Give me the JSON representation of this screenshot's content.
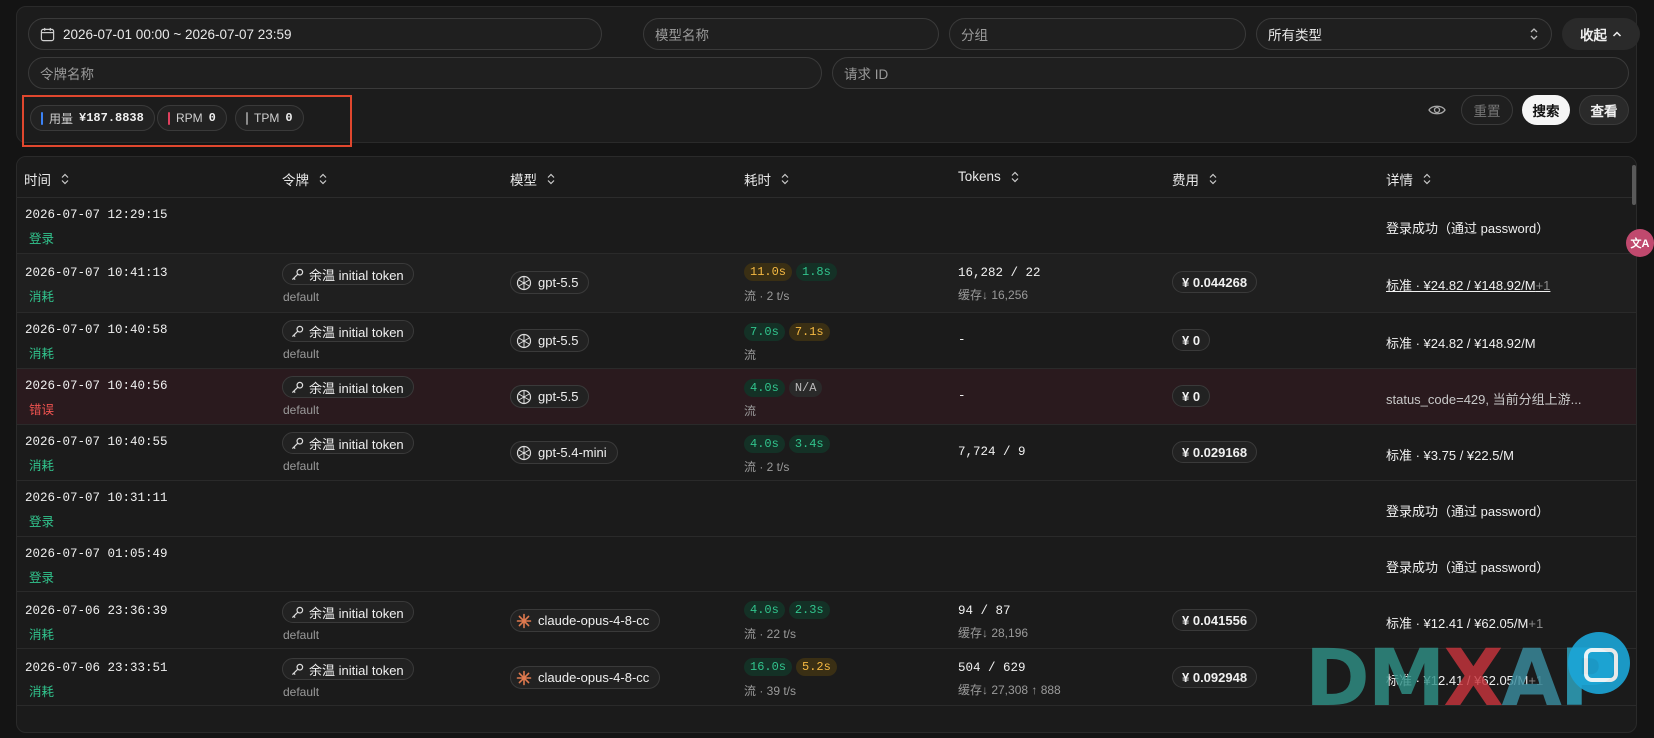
{
  "filters": {
    "date_range": "2026-07-01 00:00 ~ 2026-07-07 23:59",
    "model_placeholder": "模型名称",
    "group_placeholder": "分组",
    "type_select": "所有类型",
    "collapse_label": "收起",
    "token_placeholder": "令牌名称",
    "request_id_placeholder": "请求 ID"
  },
  "stats": {
    "usage_label": "用量",
    "usage_value": "¥187.8838",
    "rpm_label": "RPM",
    "rpm_value": "0",
    "tpm_label": "TPM",
    "tpm_value": "0",
    "colors": {
      "usage": "#3b82f6",
      "rpm": "#e0405e",
      "tpm": "#8a8a8a"
    }
  },
  "actions": {
    "reset": "重置",
    "search": "搜索",
    "view": "查看"
  },
  "columns": [
    "时间",
    "令牌",
    "模型",
    "耗时",
    "Tokens",
    "费用",
    "详情"
  ],
  "rows": [
    {
      "time": "2026-07-07 12:29:15",
      "type": "登录",
      "detail": "登录成功（通过 password）"
    },
    {
      "time": "2026-07-07 10:41:13",
      "type": "消耗",
      "token": "余温 initial token",
      "group": "default",
      "model": "gpt-5.5",
      "d1": "11.0s",
      "d2": "1.8s",
      "stream": "流 · 2 t/s",
      "tokens": "16,282 / 22",
      "cache": "缓存↓ 16,256",
      "fee": "¥ 0.044268",
      "detail": "标准 · ¥24.82 / ¥148.92/M",
      "more": "+1"
    },
    {
      "time": "2026-07-07 10:40:58",
      "type": "消耗",
      "token": "余温 initial token",
      "group": "default",
      "model": "gpt-5.5",
      "d1": "7.0s",
      "d2": "7.1s",
      "stream": "流",
      "tokens": "-",
      "fee": "¥ 0",
      "detail": "标准 · ¥24.82 / ¥148.92/M"
    },
    {
      "time": "2026-07-07 10:40:56",
      "type": "错误",
      "token": "余温 initial token",
      "group": "default",
      "model": "gpt-5.5",
      "d1": "4.0s",
      "d2": "N/A",
      "stream": "流",
      "tokens": "-",
      "fee": "¥ 0",
      "detail": "status_code=429, 当前分组上游..."
    },
    {
      "time": "2026-07-07 10:40:55",
      "type": "消耗",
      "token": "余温 initial token",
      "group": "default",
      "model": "gpt-5.4-mini",
      "d1": "4.0s",
      "d2": "3.4s",
      "stream": "流 · 2 t/s",
      "tokens": "7,724 / 9",
      "fee": "¥ 0.029168",
      "detail": "标准 · ¥3.75 / ¥22.5/M"
    },
    {
      "time": "2026-07-07 10:31:11",
      "type": "登录",
      "detail": "登录成功（通过 password）"
    },
    {
      "time": "2026-07-07 01:05:49",
      "type": "登录",
      "detail": "登录成功（通过 password）"
    },
    {
      "time": "2026-07-06 23:36:39",
      "type": "消耗",
      "token": "余温 initial token",
      "group": "default",
      "model": "claude-opus-4-8-cc",
      "d1": "4.0s",
      "d2": "2.3s",
      "stream": "流 · 22 t/s",
      "tokens": "94 / 87",
      "cache": "缓存↓ 28,196",
      "fee": "¥ 0.041556",
      "detail": "标准 · ¥12.41 / ¥62.05/M",
      "more": "+1"
    },
    {
      "time": "2026-07-06 23:33:51",
      "type": "消耗",
      "token": "余温 initial token",
      "group": "default",
      "model": "claude-opus-4-8-cc",
      "d1": "16.0s",
      "d2": "5.2s",
      "stream": "流 · 39 t/s",
      "tokens": "504 / 629",
      "cache": "缓存↓ 27,308 ↑ 888",
      "fee": "¥ 0.092948",
      "detail": "标准 · ¥12.41 / ¥62.05/M",
      "more": "+1"
    }
  ],
  "watermark": "DMXAPI",
  "translate_icon": "文A"
}
